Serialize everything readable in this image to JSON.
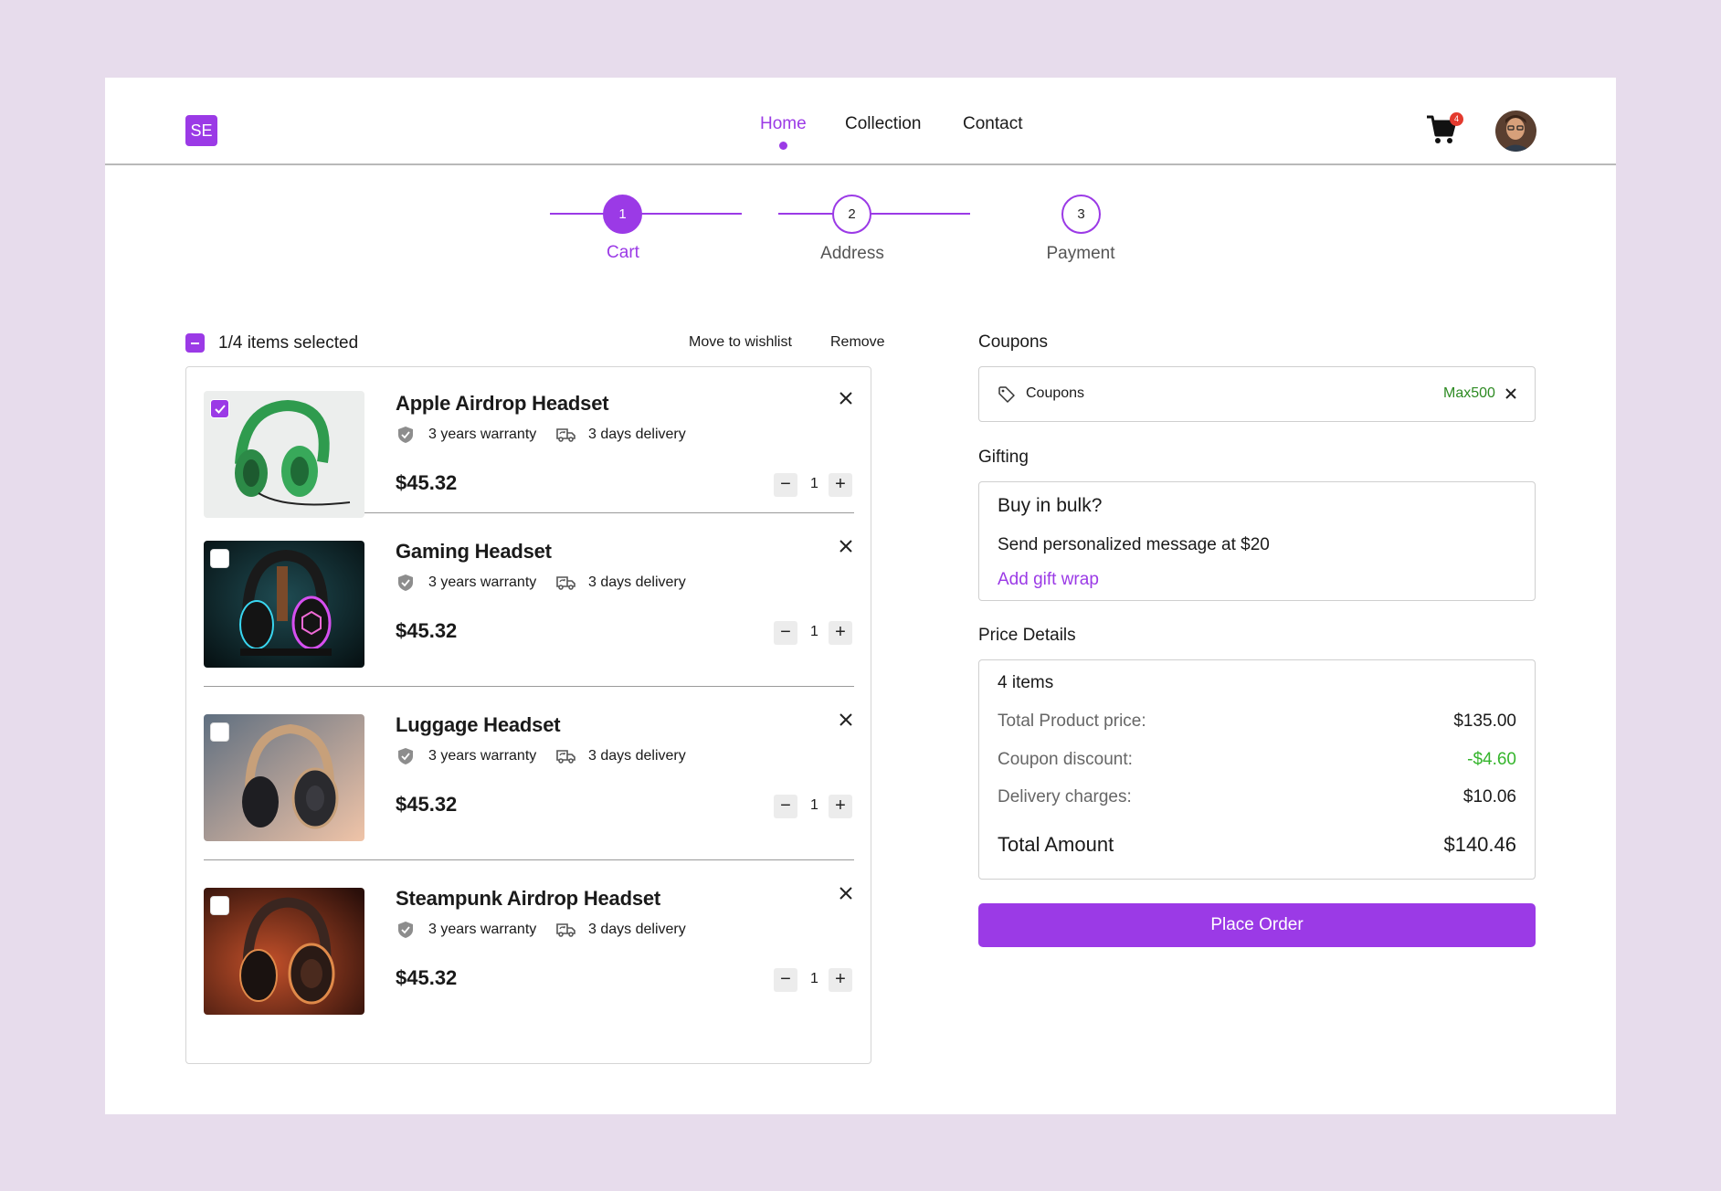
{
  "header": {
    "logo": "SE",
    "nav": [
      {
        "label": "Home",
        "active": true
      },
      {
        "label": "Collection",
        "active": false
      },
      {
        "label": "Contact",
        "active": false
      }
    ],
    "cart_count": "4",
    "avatar_icon": "user-avatar"
  },
  "stepper": [
    {
      "number": "1",
      "label": "Cart",
      "active": true
    },
    {
      "number": "2",
      "label": "Address",
      "active": false
    },
    {
      "number": "3",
      "label": "Payment",
      "active": false
    }
  ],
  "cart": {
    "selection_text": "1/4 items selected",
    "move_to_wishlist": "Move to wishlist",
    "remove": "Remove",
    "items": [
      {
        "name": "Apple Airdrop Headset",
        "warranty": "3 years warranty",
        "delivery": "3 days delivery",
        "price": "$45.32",
        "quantity": "1",
        "selected": true
      },
      {
        "name": "Gaming Headset",
        "warranty": "3 years warranty",
        "delivery": "3 days delivery",
        "price": "$45.32",
        "quantity": "1",
        "selected": false
      },
      {
        "name": "Luggage Headset",
        "warranty": "3 years warranty",
        "delivery": "3 days delivery",
        "price": "$45.32",
        "quantity": "1",
        "selected": false
      },
      {
        "name": "Steampunk Airdrop Headset",
        "warranty": "3 years warranty",
        "delivery": "3 days delivery",
        "price": "$45.32",
        "quantity": "1",
        "selected": false
      }
    ]
  },
  "coupons": {
    "title": "Coupons",
    "label": "Coupons",
    "code": "Max500"
  },
  "gifting": {
    "title": "Gifting",
    "question": "Buy in bulk?",
    "message": "Send personalized message at $20",
    "link": "Add gift wrap"
  },
  "price_details": {
    "title": "Price Details",
    "count": "4 items",
    "rows": [
      {
        "label": "Total Product price:",
        "value": "$135.00"
      },
      {
        "label": "Coupon discount:",
        "value": "-$4.60"
      },
      {
        "label": "Delivery charges:",
        "value": "$10.06"
      }
    ],
    "total_label": "Total Amount",
    "total_value": "$140.46"
  },
  "place_order": "Place Order",
  "colors": {
    "accent": "#9b3ae6",
    "discount_green": "#35b52c",
    "coupon_green": "#2d8a22",
    "badge_red": "#e33a2e",
    "background": "#e7dcec"
  }
}
